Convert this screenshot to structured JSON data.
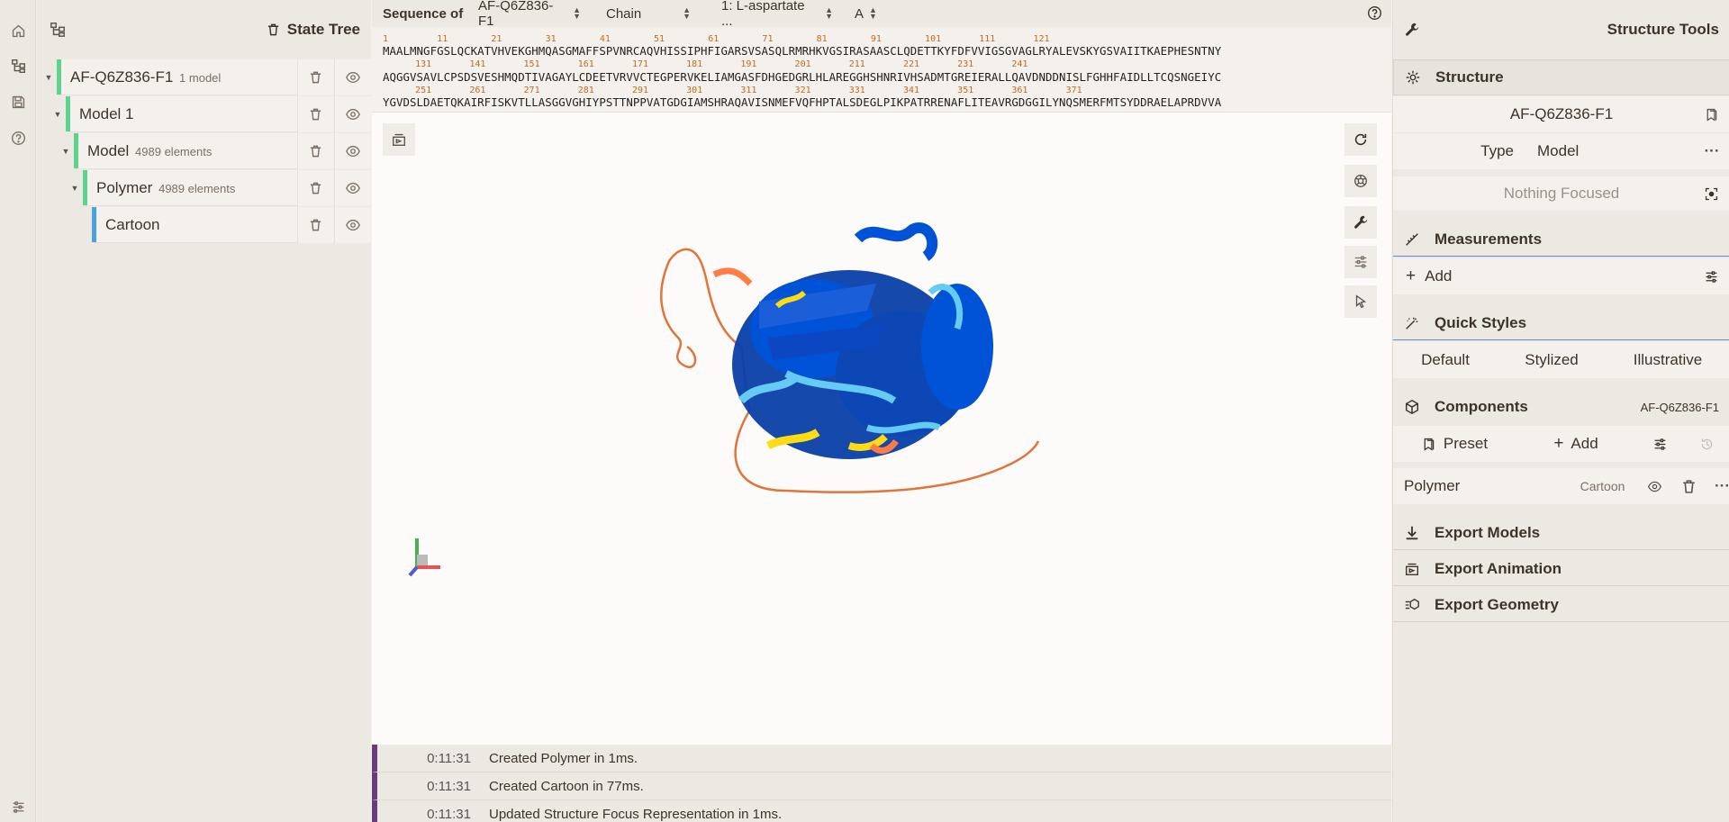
{
  "rail": {
    "items": [
      {
        "name": "home-icon"
      },
      {
        "name": "state-tree-icon"
      },
      {
        "name": "save-icon"
      },
      {
        "name": "help-icon"
      },
      {
        "name": "settings-sliders-icon"
      }
    ]
  },
  "tree": {
    "title": "State Tree",
    "rows": [
      {
        "label": "AF-Q6Z836-F1",
        "sub": "1 model",
        "color": "#5fd38d"
      },
      {
        "label": "Model 1",
        "sub": "",
        "color": "#5fd38d"
      },
      {
        "label": "Model",
        "sub": "4989 elements",
        "color": "#5fd38d"
      },
      {
        "label": "Polymer",
        "sub": "4989 elements",
        "color": "#5fd38d"
      },
      {
        "label": "Cartoon",
        "sub": "",
        "color": "#4aa3df"
      }
    ]
  },
  "sequence": {
    "label": "Sequence of",
    "entry": "AF-Q6Z836-F1",
    "mode": "Chain",
    "entity": "1: L-aspartate ...",
    "chain": "A",
    "nums1": "1         11        21        31        41        51        61        71        81        91        101       111       121",
    "line1": "MAALMNGFGSLQCKATVHVEKGHMQASGMAFFSPVNRCAQVHISSIPHFIGARSVSASQLRMRHKVGSIRASAASCLQDETTKYFDFVVIGSGVAGLRYALEVSKYGSVAIITKAEPHESNTNY",
    "nums2": "      131       141       151       161       171       181       191       201       211       221       231       241",
    "line2": "AQGGVSAVLCPSDSVESHMQDTIVAGAYLCDEETVRVVCTEGPERVKELIAMGASFDHGEDGRLHLAREGGHSHNRIVHSADMTGREIERALLQAVDNDDNISLFGHHFAIDLLTCQSNGEIYC",
    "nums3": "      251       261       271       281       291       301       311       321       331       341       351       361       371",
    "line3": "YGVDSLDAETQKAIRFISKVTLLASGGVGHIYPSTTNPPVATGDGIAMSHRAQAVISNMEFVQFHPTALSDEGLPIKPATRRENAFLITEAVRGDGGILYNQSMERFMTSYDDRAELAPRDVVA"
  },
  "viewport": {
    "buttons": [
      {
        "name": "reset-camera-icon"
      },
      {
        "name": "screenshot-icon"
      },
      {
        "name": "wrench-icon"
      },
      {
        "name": "sliders-icon"
      },
      {
        "name": "pointer-icon"
      }
    ]
  },
  "log": [
    {
      "time": "0:11:31",
      "msg": "Created Polymer in 1ms."
    },
    {
      "time": "0:11:31",
      "msg": "Created Cartoon in 77ms."
    },
    {
      "time": "0:11:31",
      "msg": "Updated Structure Focus Representation in 1ms."
    }
  ],
  "tools": {
    "title": "Structure Tools",
    "structure": {
      "title": "Structure",
      "entry": "AF-Q6Z836-F1",
      "type_label": "Type",
      "type_value": "Model",
      "focus": "Nothing Focused"
    },
    "measurements": {
      "title": "Measurements",
      "add": "Add"
    },
    "quick_styles": {
      "title": "Quick Styles",
      "options": [
        "Default",
        "Stylized",
        "Illustrative"
      ]
    },
    "components": {
      "title": "Components",
      "entry": "AF-Q6Z836-F1",
      "preset": "Preset",
      "add": "Add",
      "item": "Polymer",
      "item_repr": "Cartoon"
    },
    "exports": [
      "Export Models",
      "Export Animation",
      "Export Geometry"
    ]
  },
  "colors": {
    "very_high": "#0053d6",
    "confident": "#65cbf3",
    "low": "#ffdb13",
    "very_low": "#ff7d45",
    "accent_green": "#5fd38d",
    "accent_blue": "#4aa3df",
    "log_bar": "#6b3a7e"
  }
}
